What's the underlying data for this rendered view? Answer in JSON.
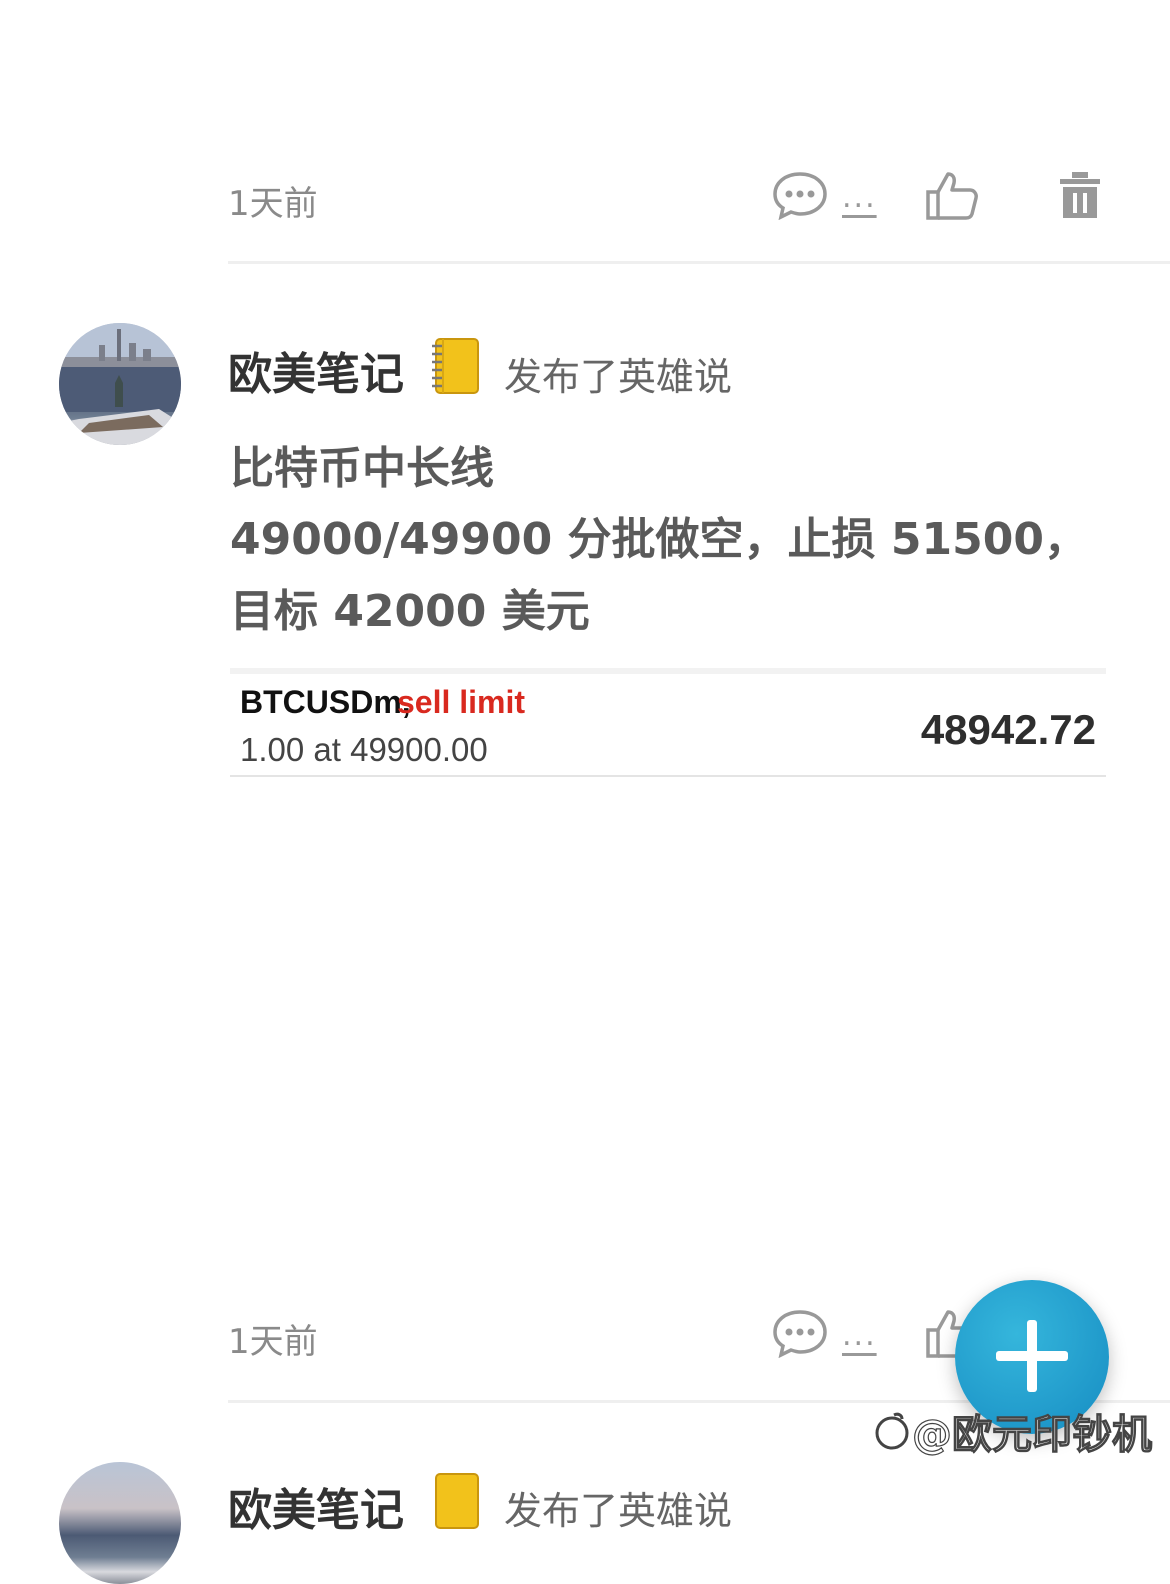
{
  "post1": {
    "time": "1天前",
    "comment_label": "...",
    "icons": {
      "comment": "comment-bubble-icon",
      "like": "thumbs-up-icon",
      "delete": "trash-icon"
    }
  },
  "post2": {
    "author": "欧美笔记",
    "author_emoji_icon": "notebook-icon",
    "action": "发布了英雄说",
    "lines": [
      "比特币中长线",
      "49000/49900 分批做空，止损 51500，",
      "目标 42000 美元"
    ],
    "order_card": {
      "symbol": "BTCUSDm,",
      "order_type": "sell limit",
      "lot_line": "1.00 at 49900.00",
      "price": "48942.72"
    },
    "time": "1天前",
    "comment_label": "..."
  },
  "post3": {
    "author": "欧美笔记",
    "action": "发布了英雄说"
  },
  "fab": {
    "icon": "plus-icon"
  },
  "watermark": "@欧元印钞机",
  "colors": {
    "accent": "#1a98cc",
    "sell": "#d9291f"
  }
}
